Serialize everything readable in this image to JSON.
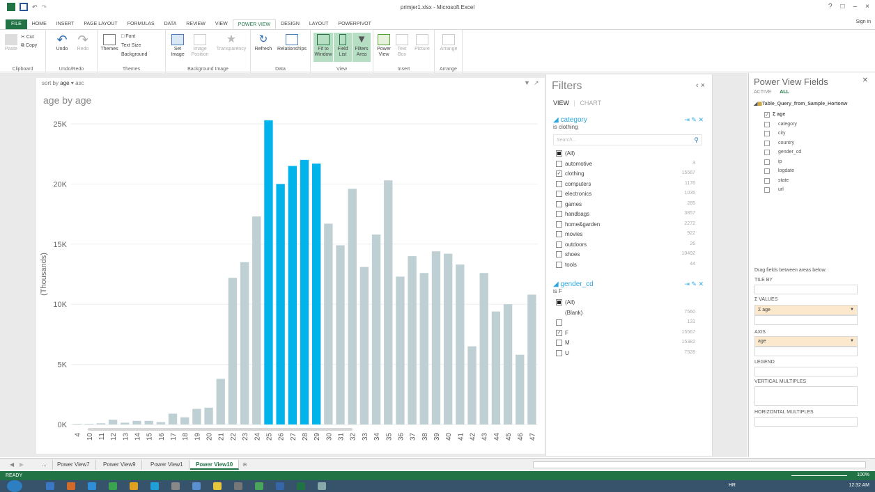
{
  "window": {
    "title": "primjer1.xlsx - Microsoft Excel",
    "controls": [
      "?",
      "□",
      "–",
      "×"
    ]
  },
  "ribbon_tabs": [
    "FILE",
    "HOME",
    "INSERT",
    "PAGE LAYOUT",
    "FORMULAS",
    "DATA",
    "REVIEW",
    "VIEW",
    "POWER VIEW",
    "DESIGN",
    "LAYOUT",
    "POWERPIVOT"
  ],
  "active_tab": "POWER VIEW",
  "signin": "Sign in",
  "ribbon": {
    "clipboard": {
      "paste": "Paste",
      "cut": "Cut",
      "copy": "Copy",
      "label": "Clipboard"
    },
    "undo": {
      "undo": "Undo",
      "redo": "Redo",
      "label": "Undo/Redo"
    },
    "themes": {
      "themes": "Themes",
      "font": "Font",
      "text_size": "Text Size",
      "background": "Background",
      "label": "Themes"
    },
    "bg_image": {
      "set": "Set Image",
      "position": "Image Position",
      "transparency": "Transparency",
      "label": "Background Image"
    },
    "data": {
      "refresh": "Refresh",
      "relationships": "Relationships",
      "label": "Data"
    },
    "view": {
      "fit": "Fit to Window",
      "field_list": "Field List",
      "filters": "Filters Area",
      "label": "View"
    },
    "insert": {
      "power_view": "Power View",
      "text_box": "Text Box",
      "picture": "Picture",
      "label": "Insert"
    },
    "arrange": {
      "arrange": "Arrange",
      "label": "Arrange"
    }
  },
  "view": {
    "sort_prefix": "sort by",
    "sort_field": "age",
    "sort_dir": "asc",
    "chart_title": "age by age"
  },
  "chart_data": {
    "type": "bar",
    "title": "age by age",
    "ylabel": "(Thousands)",
    "xlabel": "",
    "ylim": [
      0,
      25
    ],
    "yticks": [
      "0K",
      "5K",
      "10K",
      "15K",
      "20K",
      "25K"
    ],
    "categories": [
      "4",
      "10",
      "11",
      "12",
      "13",
      "14",
      "15",
      "16",
      "17",
      "18",
      "19",
      "20",
      "21",
      "22",
      "23",
      "24",
      "25",
      "26",
      "27",
      "28",
      "29",
      "30",
      "31",
      "32",
      "33",
      "34",
      "35",
      "36",
      "37",
      "38",
      "39",
      "40",
      "41",
      "42",
      "43",
      "44",
      "45",
      "46",
      "47"
    ],
    "values": [
      0.05,
      0.05,
      0.1,
      0.4,
      0.15,
      0.3,
      0.3,
      0.2,
      0.9,
      0.6,
      1.3,
      1.4,
      3.8,
      12.2,
      13.5,
      17.3,
      25.3,
      20.0,
      21.5,
      22.0,
      21.7,
      16.7,
      14.9,
      19.6,
      13.1,
      15.8,
      20.3,
      12.3,
      14.0,
      12.6,
      14.4,
      14.2,
      13.3,
      6.5,
      12.6,
      9.4,
      10.0,
      5.8,
      10.8
    ],
    "highlighted": [
      "25",
      "26",
      "27",
      "28",
      "29"
    ],
    "colors": {
      "normal": "#bfd0d4",
      "highlight": "#00b3ea"
    }
  },
  "filters": {
    "title": "Filters",
    "controls": "‹  ×",
    "tab_view": "VIEW",
    "tab_chart": "CHART",
    "category": {
      "name": "category",
      "condition": "is clothing",
      "search_placeholder": "Search...",
      "items": [
        {
          "label": "(All)",
          "count": "",
          "state": "partial"
        },
        {
          "label": "automotive",
          "count": "3",
          "state": "off"
        },
        {
          "label": "clothing",
          "count": "15567",
          "state": "on"
        },
        {
          "label": "computers",
          "count": "1176",
          "state": "off"
        },
        {
          "label": "electronics",
          "count": "1035",
          "state": "off"
        },
        {
          "label": "games",
          "count": "285",
          "state": "off"
        },
        {
          "label": "handbags",
          "count": "3857",
          "state": "off"
        },
        {
          "label": "home&garden",
          "count": "2272",
          "state": "off"
        },
        {
          "label": "movies",
          "count": "922",
          "state": "off"
        },
        {
          "label": "outdoors",
          "count": "26",
          "state": "off"
        },
        {
          "label": "shoes",
          "count": "10492",
          "state": "off"
        },
        {
          "label": "tools",
          "count": "44",
          "state": "off"
        }
      ]
    },
    "gender": {
      "name": "gender_cd",
      "condition": "is F",
      "items": [
        {
          "label": "(All)",
          "count": "",
          "state": "partial"
        },
        {
          "label": "(Blank)",
          "count": "7560",
          "state": "none"
        },
        {
          "label": "",
          "count": "131",
          "state": "off"
        },
        {
          "label": "F",
          "count": "15567",
          "state": "on"
        },
        {
          "label": "M",
          "count": "15382",
          "state": "off"
        },
        {
          "label": "U",
          "count": "7528",
          "state": "off"
        }
      ]
    }
  },
  "fields_pane": {
    "title": "Power View Fields",
    "tab_active": "ACTIVE",
    "tab_all": "ALL",
    "table": "Table_Query_from_Sample_Hortonw",
    "fields": [
      {
        "label": "Σ age",
        "checked": true
      },
      {
        "label": "category",
        "checked": false
      },
      {
        "label": "city",
        "checked": false
      },
      {
        "label": "country",
        "checked": false
      },
      {
        "label": "gender_cd",
        "checked": false
      },
      {
        "label": "ip",
        "checked": false
      },
      {
        "label": "logdate",
        "checked": false
      },
      {
        "label": "state",
        "checked": false
      },
      {
        "label": "url",
        "checked": false
      }
    ],
    "drag_hint": "Drag fields between areas below:",
    "tile_by": "TILE BY",
    "values_label": "Σ VALUES",
    "values_field": "Σ age",
    "axis_label": "AXIS",
    "axis_field": "age",
    "legend": "LEGEND",
    "vertical": "VERTICAL MULTIPLES",
    "horizontal": "HORIZONTAL MULTIPLES"
  },
  "sheet_tabs": [
    "...",
    "Power View7",
    "Power View9",
    "Power View1",
    "Power View10"
  ],
  "active_sheet": "Power View10",
  "status": {
    "ready": "READY",
    "zoom": "100%"
  },
  "taskbar": {
    "lang": "HR",
    "time": "12:32 AM"
  }
}
